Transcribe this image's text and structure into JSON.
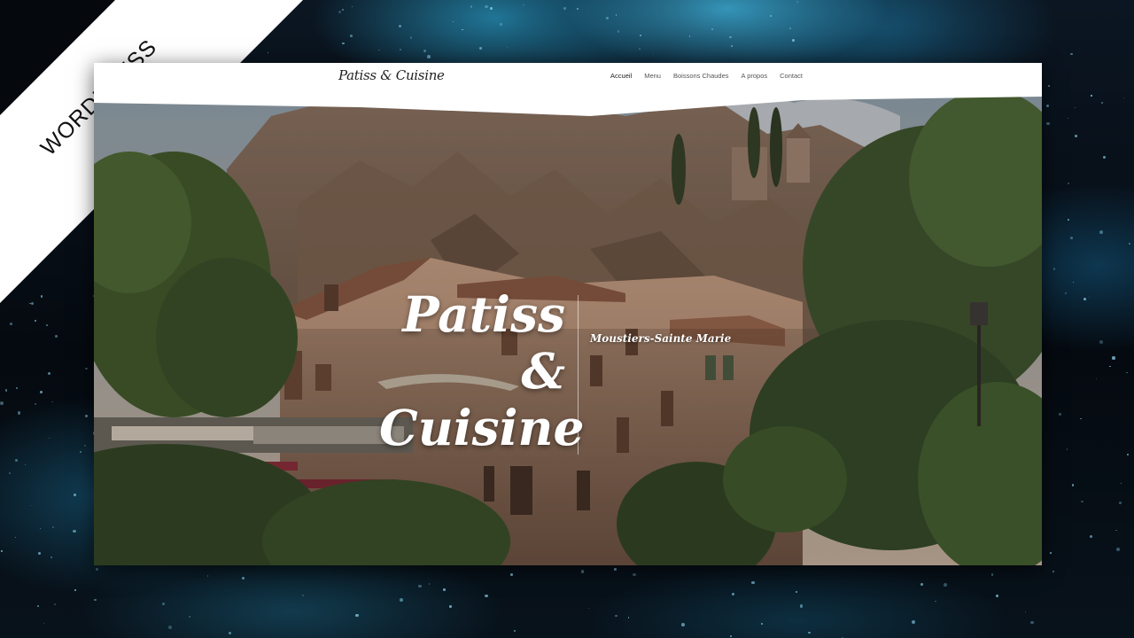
{
  "ribbon": {
    "label": "WORDPRESS"
  },
  "site": {
    "logo": "Patiss & Cuisine",
    "nav": [
      "Accueil",
      "Menu",
      "Boissons Chaudes",
      "A propos",
      "Contact"
    ],
    "hero": {
      "title_lines": [
        "Patiss",
        "&",
        "Cuisine"
      ],
      "subtitle": "Moustiers-Sainte Marie"
    }
  },
  "colors": {
    "ribbon": "#ffffff",
    "navbar": "#ffffff",
    "hero_text": "#ffffff",
    "background_accent": "#3aa6d0"
  }
}
